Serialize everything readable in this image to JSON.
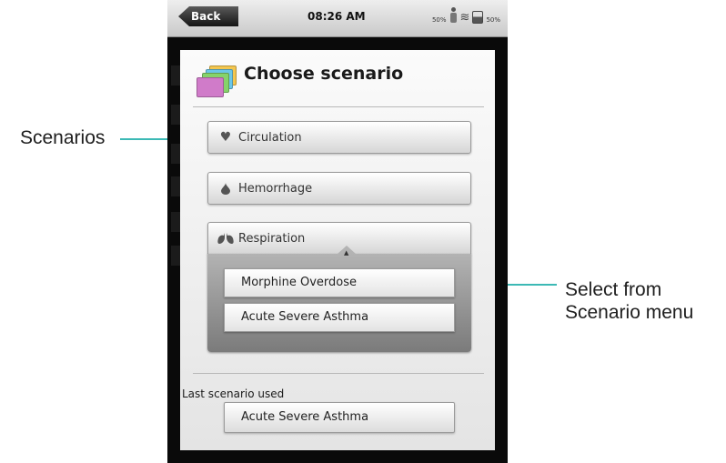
{
  "statusbar": {
    "back_label": "Back",
    "time": "08:26 AM",
    "left_pct": "50%",
    "right_pct": "50%"
  },
  "dialog": {
    "title": "Choose scenario",
    "scenarios": [
      {
        "label": "Circulation",
        "icon": "heart-icon"
      },
      {
        "label": "Hemorrhage",
        "icon": "drop-icon"
      },
      {
        "label": "Respiration",
        "icon": "lungs-icon"
      }
    ],
    "submenu": [
      "Morphine Overdose",
      "Acute Severe Asthma"
    ],
    "last_label": "Last scenario used",
    "last_value": "Acute Severe Asthma"
  },
  "callouts": {
    "scenarios": "Scenarios",
    "select": "Select from Scenario menu"
  },
  "colors": {
    "callout": "#3cb9b5",
    "panel": "#e4e4e4",
    "device": "#0a0a0a"
  }
}
